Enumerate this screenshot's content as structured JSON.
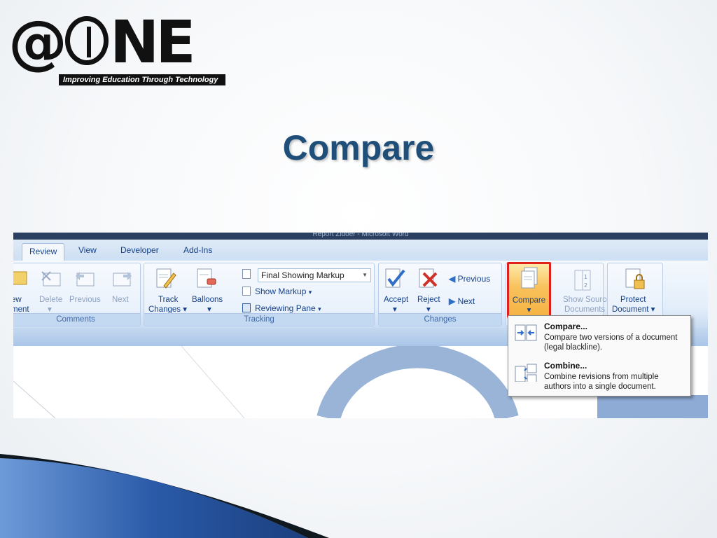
{
  "logo": {
    "text_at": "@",
    "text_ne": "NE",
    "tagline": "Improving Education Through Technology"
  },
  "slide": {
    "title": "Compare"
  },
  "word": {
    "window_title": "Report Zidoer - Microsoft Word",
    "tabs": [
      "Review",
      "View",
      "Developer",
      "Add-Ins"
    ],
    "comments": {
      "new_label_1": "ew",
      "new_label_2": "ment",
      "delete": "Delete",
      "previous": "Previous",
      "next": "Next",
      "group": "Comments"
    },
    "tracking": {
      "track_1": "Track",
      "track_2": "Changes",
      "balloons": "Balloons",
      "display_select": "Final Showing Markup",
      "show_markup": "Show Markup",
      "reviewing_pane": "Reviewing Pane",
      "group": "Tracking"
    },
    "changes": {
      "accept": "Accept",
      "reject": "Reject",
      "previous": "Previous",
      "next": "Next",
      "group": "Changes"
    },
    "compare": {
      "button": "Compare",
      "show_source_1": "Show Source",
      "show_source_2": "Documents",
      "protect_1": "Protect",
      "protect_2": "Document"
    },
    "menu": {
      "items": [
        {
          "title": "Compare...",
          "desc": "Compare two versions of a document (legal blackline)."
        },
        {
          "title": "Combine...",
          "desc": "Combine revisions from multiple authors into a single document."
        }
      ]
    }
  },
  "colors": {
    "title": "#1f4e79",
    "highlight": "#e0201a",
    "ribbon": "#dfeaf7",
    "swoosh": "#2a5aa8"
  }
}
